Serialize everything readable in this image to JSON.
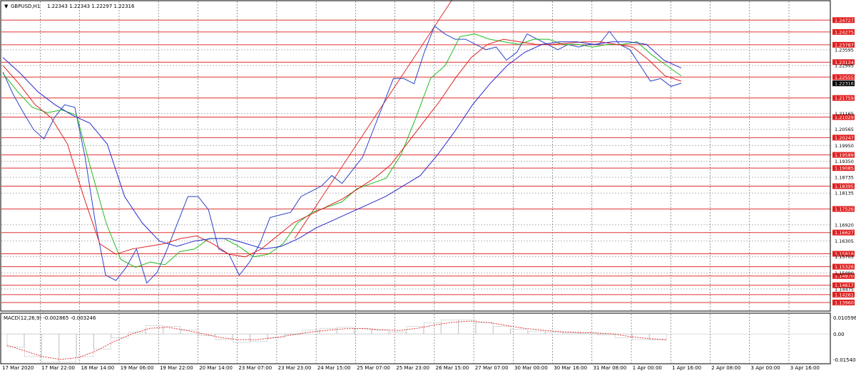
{
  "header": {
    "symbol": "GBPUSD,H1",
    "ohlc": "1.22343 1.22343 1.22297 1.22316"
  },
  "macd": {
    "label": "MACD(12,26,9) -0.002865 -0.003246",
    "axis": {
      "top": "0.010596",
      "zero": "0.00",
      "bottom": "-0.015404"
    }
  },
  "colors": {
    "price": "#2a44c8",
    "ma_fast": "#22bb22",
    "ma_mid": "#dd2222",
    "ma_slow": "#2a2ad0",
    "level_line": "#e23030",
    "level_box": "#e02020",
    "current_box": "#000000"
  },
  "chart_data": {
    "type": "line",
    "ylim": [
      1.1366,
      1.2544
    ],
    "x_labels": [
      "17 Mar 2020",
      "17 Mar 22:00",
      "18 Mar 14:00",
      "19 Mar 06:00",
      "19 Mar 22:00",
      "20 Mar 14:00",
      "23 Mar 07:00",
      "23 Mar 23:00",
      "24 Mar 15:00",
      "25 Mar 07:00",
      "25 Mar 23:00",
      "26 Mar 15:00",
      "27 Mar 07:00",
      "30 Mar 00:00",
      "30 Mar 16:00",
      "31 Mar 08:00",
      "1 Apr 00:00",
      "1 Apr 16:00",
      "2 Apr 08:00",
      "3 Apr 00:00",
      "3 Apr 16:00"
    ],
    "y_ticks": [
      "1.23595",
      "1.22995",
      "1.21165",
      "1.20565",
      "1.19950",
      "1.19350",
      "1.18735",
      "1.18135",
      "1.16920",
      "1.16305",
      "1.15705",
      "1.15090",
      "1.14475"
    ],
    "levels": [
      "1.24727",
      "1.24275",
      "1.23787",
      "1.23124",
      "1.22555",
      "1.21759",
      "1.21029",
      "1.20247",
      "1.19589",
      "1.19085",
      "1.18395",
      "1.17526",
      "1.16627",
      "1.15818",
      "1.15326",
      "1.14970",
      "1.14617",
      "1.14261",
      "1.13960"
    ],
    "current_price": "1.22316",
    "series": [
      {
        "values": [
          1.2275,
          1.219,
          1.212,
          1.2055,
          1.202,
          1.21,
          1.215,
          1.214,
          1.195,
          1.17,
          1.15,
          1.148,
          1.153,
          1.16,
          1.147,
          1.151,
          1.16,
          1.17,
          1.18,
          1.18,
          1.175,
          1.16,
          1.158,
          1.15,
          1.155,
          1.162,
          1.172,
          1.173,
          1.174,
          1.18,
          1.182,
          1.184,
          1.188,
          1.185,
          1.19,
          1.195,
          1.205,
          1.215,
          1.225,
          1.225,
          1.223,
          1.235,
          1.245,
          1.242,
          1.24,
          1.24,
          1.238,
          1.236,
          1.237,
          1.232,
          1.235,
          1.242,
          1.24,
          1.238,
          1.236,
          1.238,
          1.237,
          1.238,
          1.238,
          1.243,
          1.238,
          1.236,
          1.23,
          1.224,
          1.225,
          1.222,
          1.2232
        ]
      },
      {
        "values": [
          1.227,
          1.22,
          1.214,
          1.212,
          1.213,
          1.211,
          1.19,
          1.17,
          1.156,
          1.153,
          1.155,
          1.154,
          1.159,
          1.16,
          1.164,
          1.164,
          1.161,
          1.157,
          1.158,
          1.162,
          1.17,
          1.174,
          1.176,
          1.178,
          1.183,
          1.185,
          1.187,
          1.196,
          1.21,
          1.225,
          1.23,
          1.241,
          1.242,
          1.24,
          1.239,
          1.238,
          1.24,
          1.24,
          1.238,
          1.238,
          1.237,
          1.238,
          1.238,
          1.239,
          1.234,
          1.23,
          1.226
        ]
      },
      {
        "values": [
          1.23,
          1.223,
          1.215,
          1.21,
          1.2,
          1.18,
          1.162,
          1.158,
          1.16,
          1.161,
          1.162,
          1.164,
          1.165,
          1.162,
          1.158,
          1.157,
          1.16,
          1.165,
          1.17,
          1.173,
          1.176,
          1.179,
          1.183,
          1.187,
          1.192,
          1.2,
          1.208,
          1.216,
          1.225,
          1.233,
          1.238,
          1.24,
          1.239,
          1.238,
          1.238,
          1.2385,
          1.239,
          1.239,
          1.238,
          1.237,
          1.232,
          1.226,
          1.224
        ]
      },
      {
        "values": [
          1.233,
          1.227,
          1.22,
          1.215,
          1.211,
          1.208,
          1.2,
          1.18,
          1.17,
          1.163,
          1.161,
          1.163,
          1.164,
          1.164,
          1.162,
          1.16,
          1.161,
          1.164,
          1.168,
          1.171,
          1.174,
          1.177,
          1.18,
          1.184,
          1.188,
          1.196,
          1.205,
          1.215,
          1.223,
          1.23,
          1.235,
          1.238,
          1.239,
          1.239,
          1.238,
          1.239,
          1.239,
          1.238,
          1.232,
          1.229
        ]
      }
    ],
    "macd_values": [
      -0.007,
      -0.012,
      -0.015,
      -0.015,
      -0.012,
      -0.008,
      -0.002,
      0.001,
      0.0045,
      0.004,
      0.002,
      -0.001,
      -0.003,
      -0.0045,
      -0.004,
      -0.002,
      0.0,
      0.002,
      0.003,
      0.0035,
      0.003,
      0.002,
      0.001,
      0.004,
      0.006,
      0.0075,
      0.0075,
      0.006,
      0.004,
      0.0025,
      0.0015,
      0.001,
      0.0005,
      0.0005,
      -0.0005,
      -0.002,
      -0.003,
      -0.0032
    ],
    "signal_values": [
      -0.006,
      -0.009,
      -0.012,
      -0.0135,
      -0.0125,
      -0.009,
      -0.004,
      0.0,
      0.003,
      0.0035,
      0.002,
      0.0,
      -0.002,
      -0.003,
      -0.003,
      -0.002,
      -0.0005,
      0.001,
      0.002,
      0.0028,
      0.0028,
      0.0022,
      0.0018,
      0.003,
      0.0048,
      0.0062,
      0.0068,
      0.006,
      0.0045,
      0.003,
      0.002,
      0.0012,
      0.0008,
      0.0005,
      0.0,
      -0.0015,
      -0.0025,
      -0.003
    ]
  }
}
